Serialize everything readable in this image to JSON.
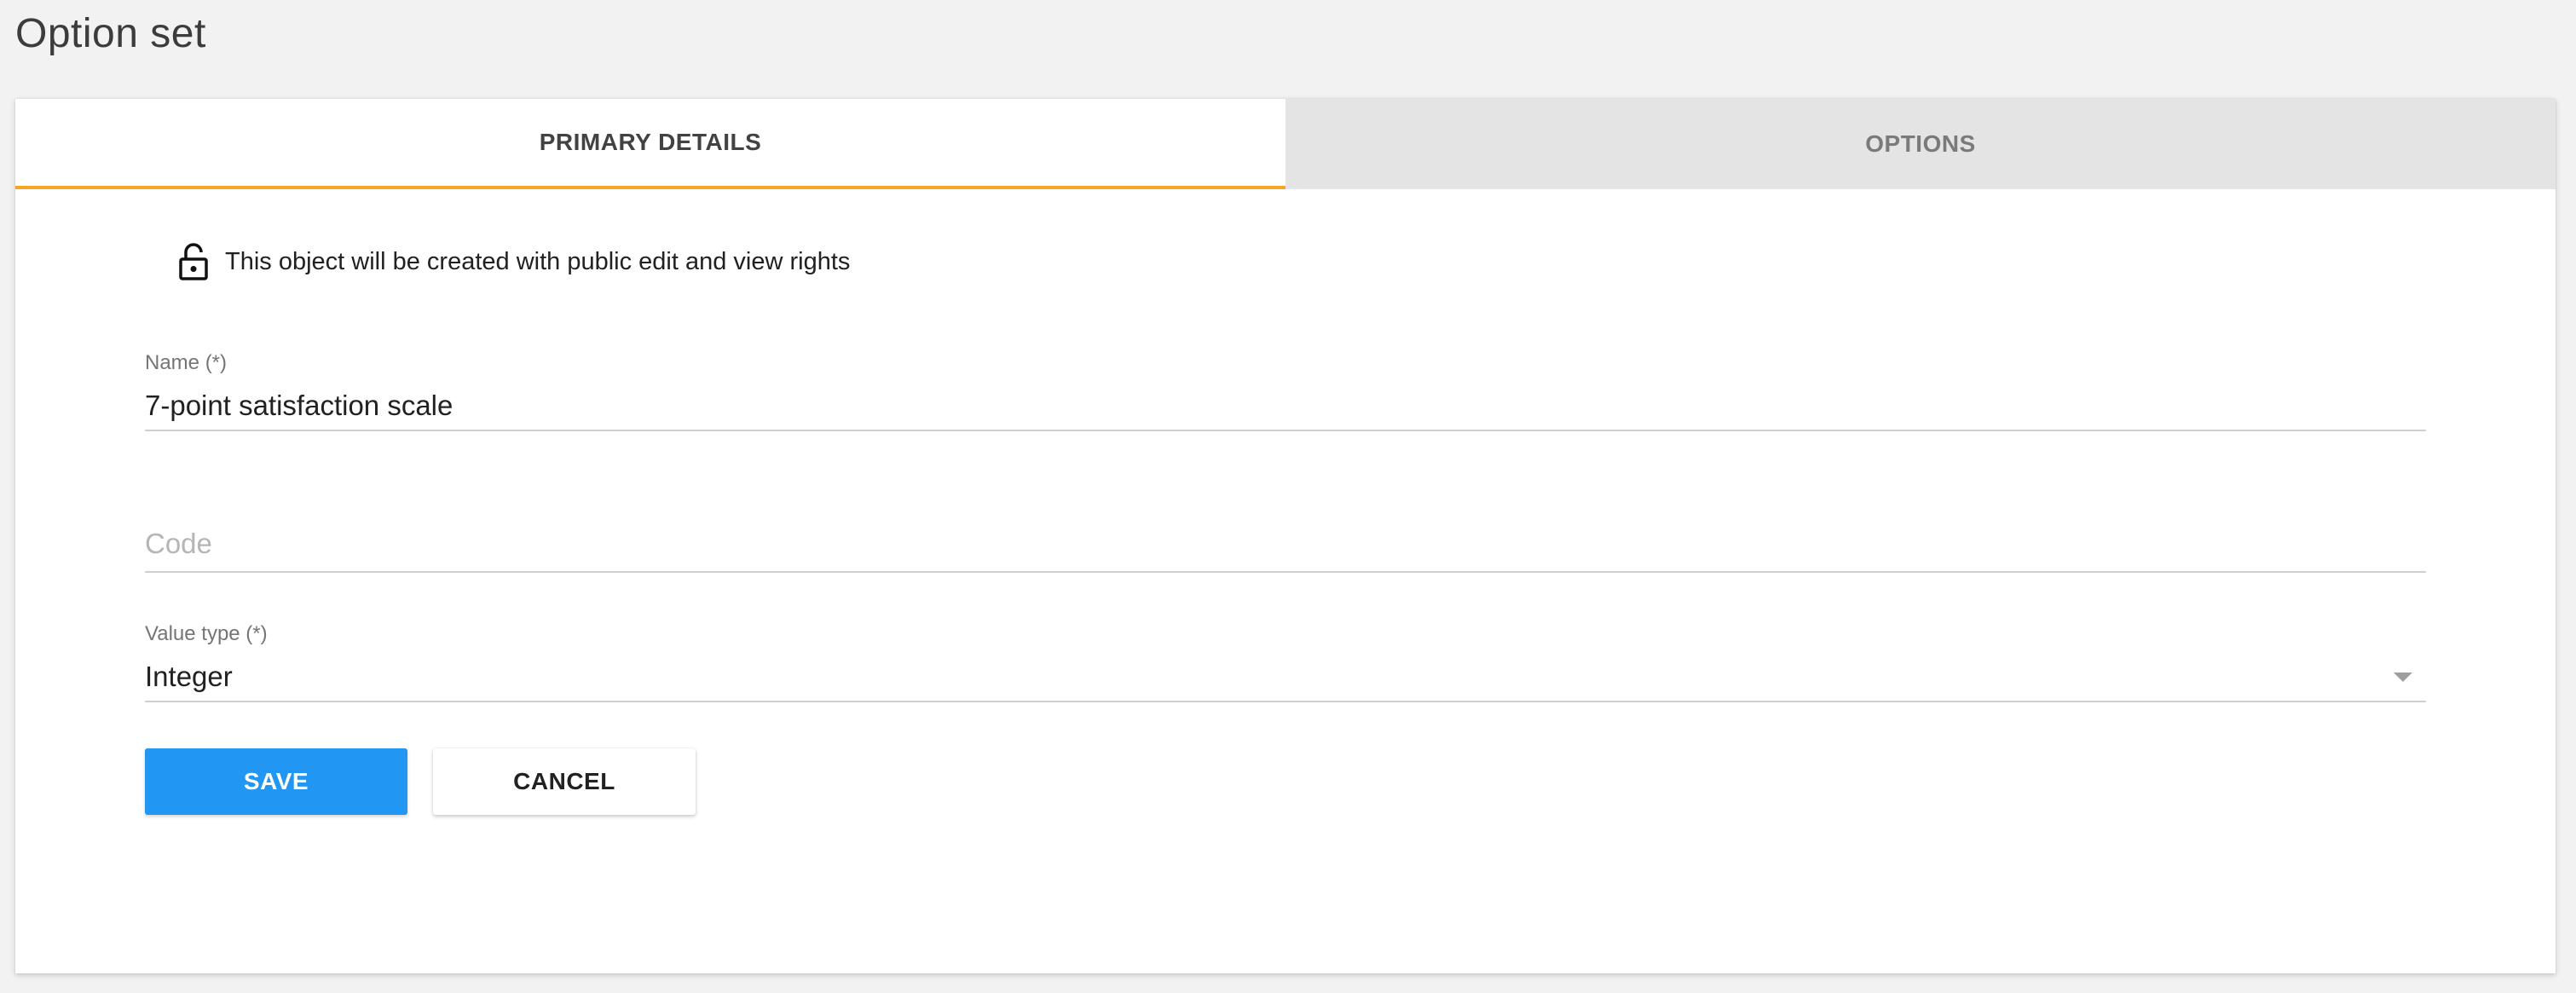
{
  "page": {
    "title": "Option set"
  },
  "tabs": [
    {
      "label": "PRIMARY DETAILS",
      "active": true
    },
    {
      "label": "OPTIONS",
      "active": false
    }
  ],
  "notice": {
    "icon": "lock-open-icon",
    "text": "This object will be created with public edit and view rights"
  },
  "form": {
    "name": {
      "label": "Name (*)",
      "value": "7-point satisfaction scale"
    },
    "code": {
      "placeholder": "Code",
      "value": ""
    },
    "value_type": {
      "label": "Value type (*)",
      "selected": "Integer"
    }
  },
  "actions": {
    "save_label": "SAVE",
    "cancel_label": "CANCEL"
  },
  "colors": {
    "accent_tab_underline": "#f6a623",
    "primary_button": "#2196f3",
    "background": "#f2f2f2"
  }
}
